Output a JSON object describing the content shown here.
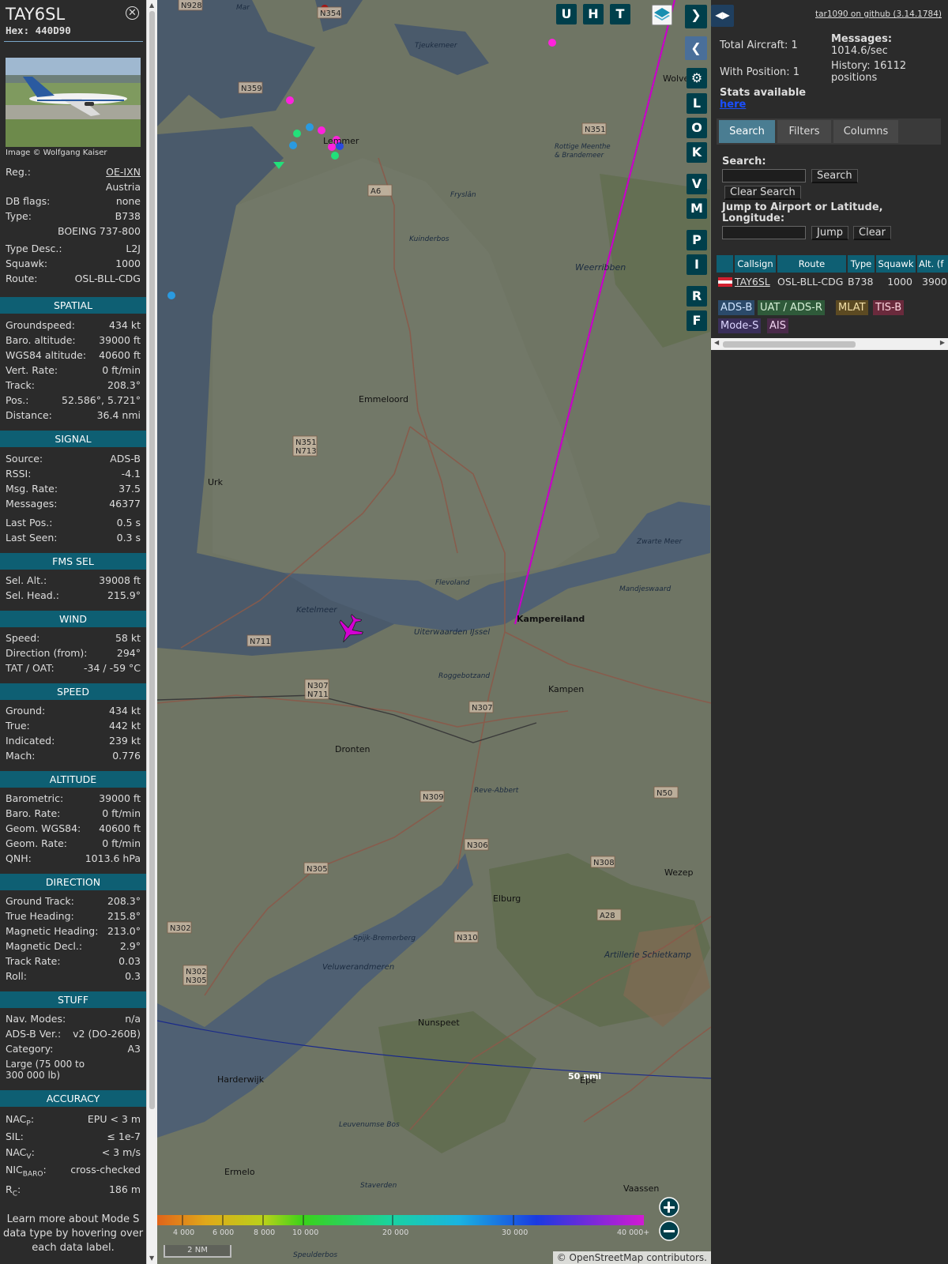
{
  "aircraft": {
    "callsign": "TAY6SL",
    "hex": "Hex: 440D90",
    "image_credit": "Image © Wolfgang Kaiser",
    "reg_label": "Reg.:",
    "reg": "OE-IXN",
    "country": "Austria",
    "dbflags_label": "DB flags:",
    "dbflags": "none",
    "type_label": "Type:",
    "type": "B738",
    "type_full": "BOEING 737-800",
    "type_desc_label": "Type Desc.:",
    "type_desc": "L2J",
    "squawk_label": "Squawk:",
    "squawk": "1000",
    "route_label": "Route:",
    "route": "OSL-BLL-CDG"
  },
  "sections": {
    "spatial": {
      "title": "SPATIAL",
      "rows": [
        {
          "label": "Groundspeed:",
          "value": "434 kt"
        },
        {
          "label": "Baro. altitude:",
          "value": "39000 ft"
        },
        {
          "label": "WGS84 altitude:",
          "value": "40600 ft"
        },
        {
          "label": "Vert. Rate:",
          "value": "0 ft/min"
        },
        {
          "label": "Track:",
          "value": "208.3°"
        },
        {
          "label": "Pos.:",
          "value": "52.586°, 5.721°"
        },
        {
          "label": "Distance:",
          "value": "36.4 nmi"
        }
      ]
    },
    "signal": {
      "title": "SIGNAL",
      "rows": [
        {
          "label": "Source:",
          "value": "ADS-B"
        },
        {
          "label": "RSSI:",
          "value": "-4.1"
        },
        {
          "label": "Msg. Rate:",
          "value": "37.5"
        },
        {
          "label": "Messages:",
          "value": "46377"
        },
        {
          "label": "Last Pos.:",
          "value": "0.5 s"
        },
        {
          "label": "Last Seen:",
          "value": "0.3 s"
        }
      ]
    },
    "fms": {
      "title": "FMS SEL",
      "rows": [
        {
          "label": "Sel. Alt.:",
          "value": "39008 ft"
        },
        {
          "label": "Sel. Head.:",
          "value": "215.9°"
        }
      ]
    },
    "wind": {
      "title": "WIND",
      "rows": [
        {
          "label": "Speed:",
          "value": "58 kt"
        },
        {
          "label": "Direction (from):",
          "value": "294°"
        },
        {
          "label": "TAT / OAT:",
          "value": "-34 / -59 °C"
        }
      ]
    },
    "speed": {
      "title": "SPEED",
      "rows": [
        {
          "label": "Ground:",
          "value": "434 kt"
        },
        {
          "label": "True:",
          "value": "442 kt"
        },
        {
          "label": "Indicated:",
          "value": "239 kt"
        },
        {
          "label": "Mach:",
          "value": "0.776"
        }
      ]
    },
    "altitude": {
      "title": "ALTITUDE",
      "rows": [
        {
          "label": "Barometric:",
          "value": "39000 ft"
        },
        {
          "label": "Baro. Rate:",
          "value": "0 ft/min"
        },
        {
          "label": "Geom. WGS84:",
          "value": "40600 ft"
        },
        {
          "label": "Geom. Rate:",
          "value": "0 ft/min"
        },
        {
          "label": "QNH:",
          "value": "1013.6 hPa"
        }
      ]
    },
    "direction": {
      "title": "DIRECTION",
      "rows": [
        {
          "label": "Ground Track:",
          "value": "208.3°"
        },
        {
          "label": "True Heading:",
          "value": "215.8°"
        },
        {
          "label": "Magnetic Heading:",
          "value": "213.0°"
        },
        {
          "label": "Magnetic Decl.:",
          "value": "2.9°"
        },
        {
          "label": "Track Rate:",
          "value": "0.03"
        },
        {
          "label": "Roll:",
          "value": "0.3"
        }
      ]
    },
    "stuff": {
      "title": "STUFF",
      "rows": [
        {
          "label": "Nav. Modes:",
          "value": "n/a"
        },
        {
          "label": "ADS-B Ver.:",
          "value": "v2 (DO-260B)"
        },
        {
          "label": "Category:",
          "value": "A3"
        }
      ],
      "category_desc": "Large (75 000 to 300 000 lb)"
    },
    "accuracy": {
      "title": "ACCURACY",
      "rows": [
        {
          "label": "NACP:",
          "value": "EPU < 3 m"
        },
        {
          "label": "SIL:",
          "value": "≤ 1e-7"
        },
        {
          "label": "NACV:",
          "value": "< 3 m/s"
        },
        {
          "label": "NICBARO:",
          "value": "cross-checked"
        },
        {
          "label": "RC:",
          "value": "186 m"
        }
      ]
    }
  },
  "footnote": "Learn more about Mode S data type by hovering over each data label.",
  "map": {
    "buttons_top": [
      "U",
      "H",
      "T"
    ],
    "buttons_side": [
      "L",
      "O",
      "K",
      "V",
      "M",
      "P",
      "I",
      "R",
      "F"
    ],
    "place_labels": [
      "Lemmer",
      "Emmeloord",
      "Urk",
      "Kampereiland",
      "Kampen",
      "Dronten",
      "Elburg",
      "Nunspeet",
      "Harderwijk",
      "Ermelo",
      "Epe",
      "Wezep",
      "Vaassen",
      "Zwarte Meer",
      "Mandjeswaard",
      "Ketelmeer",
      "Uiterwaarden IJssel",
      "Flevoland",
      "Weerribben",
      "Kuinderbos",
      "Rottige Meenthe & Brandemeer",
      "Artillerie Schietkamp",
      "Veluwerandmeren",
      "Spijk-Bremerberg",
      "Reve-Abbert",
      "Roggebotzand",
      "Leuvenumse Bos",
      "Staverden",
      "Speulderbos",
      "Tjeukemeer",
      "Fryslân",
      "Wolve",
      "Mar"
    ],
    "road_labels": [
      "N928",
      "N354",
      "N359",
      "N351",
      "A6",
      "N351 N713",
      "N711",
      "N307 N711",
      "N307",
      "N309",
      "N306",
      "N305",
      "N302",
      "N302 N305",
      "N308",
      "N310",
      "A28",
      "N50"
    ],
    "scale_50nm": "50 nmi",
    "altitude_legend": [
      "4 000",
      "6 000",
      "8 000",
      "10 000",
      "20 000",
      "30 000",
      "40 000+"
    ],
    "scale": "2 NM",
    "attribution": "© OpenStreetMap contributors."
  },
  "side": {
    "github": "tar1090 on github (3.14.1784)",
    "total_aircraft": "Total Aircraft: 1",
    "with_position": "With Position: 1",
    "stats_available": "Stats available",
    "stats_link": "here",
    "messages_label": "Messages:",
    "messages_rate": "1014.6/sec",
    "history": "History: 16112 positions",
    "tabs": [
      "Search",
      "Filters",
      "Columns"
    ],
    "search_label": "Search:",
    "search_button": "Search",
    "clear_search_button": "Clear Search",
    "jump_label": "Jump to Airport or Latitude, Longitude:",
    "jump_button": "Jump",
    "clear_button": "Clear",
    "table_headers": [
      "Callsign",
      "Route",
      "Type",
      "Squawk",
      "Alt. (f"
    ],
    "table_row": {
      "callsign": "TAY6SL",
      "route": "OSL-BLL-CDG",
      "type": "B738",
      "squawk": "1000",
      "alt": "3900"
    },
    "source_badges": [
      {
        "label": "ADS-B",
        "color": "#2b4a6a",
        "text": "#cfe4ff"
      },
      {
        "label": "UAT / ADS-R",
        "color": "#2f5a3a",
        "text": "#d6f0d6"
      },
      {
        "label": "MLAT",
        "color": "#5c4a22",
        "text": "#f3e0a8"
      },
      {
        "label": "TIS-B",
        "color": "#6a2a3c",
        "text": "#ffd6e0"
      },
      {
        "label": "Mode-S",
        "color": "#3a2f5a",
        "text": "#ddd6ff"
      },
      {
        "label": "AIS",
        "color": "#4a2a4a",
        "text": "#f2d6f2"
      }
    ]
  },
  "colors": {
    "accent": "#0e5f73",
    "track": "#c800c8",
    "button_bg": "#003f4b"
  }
}
